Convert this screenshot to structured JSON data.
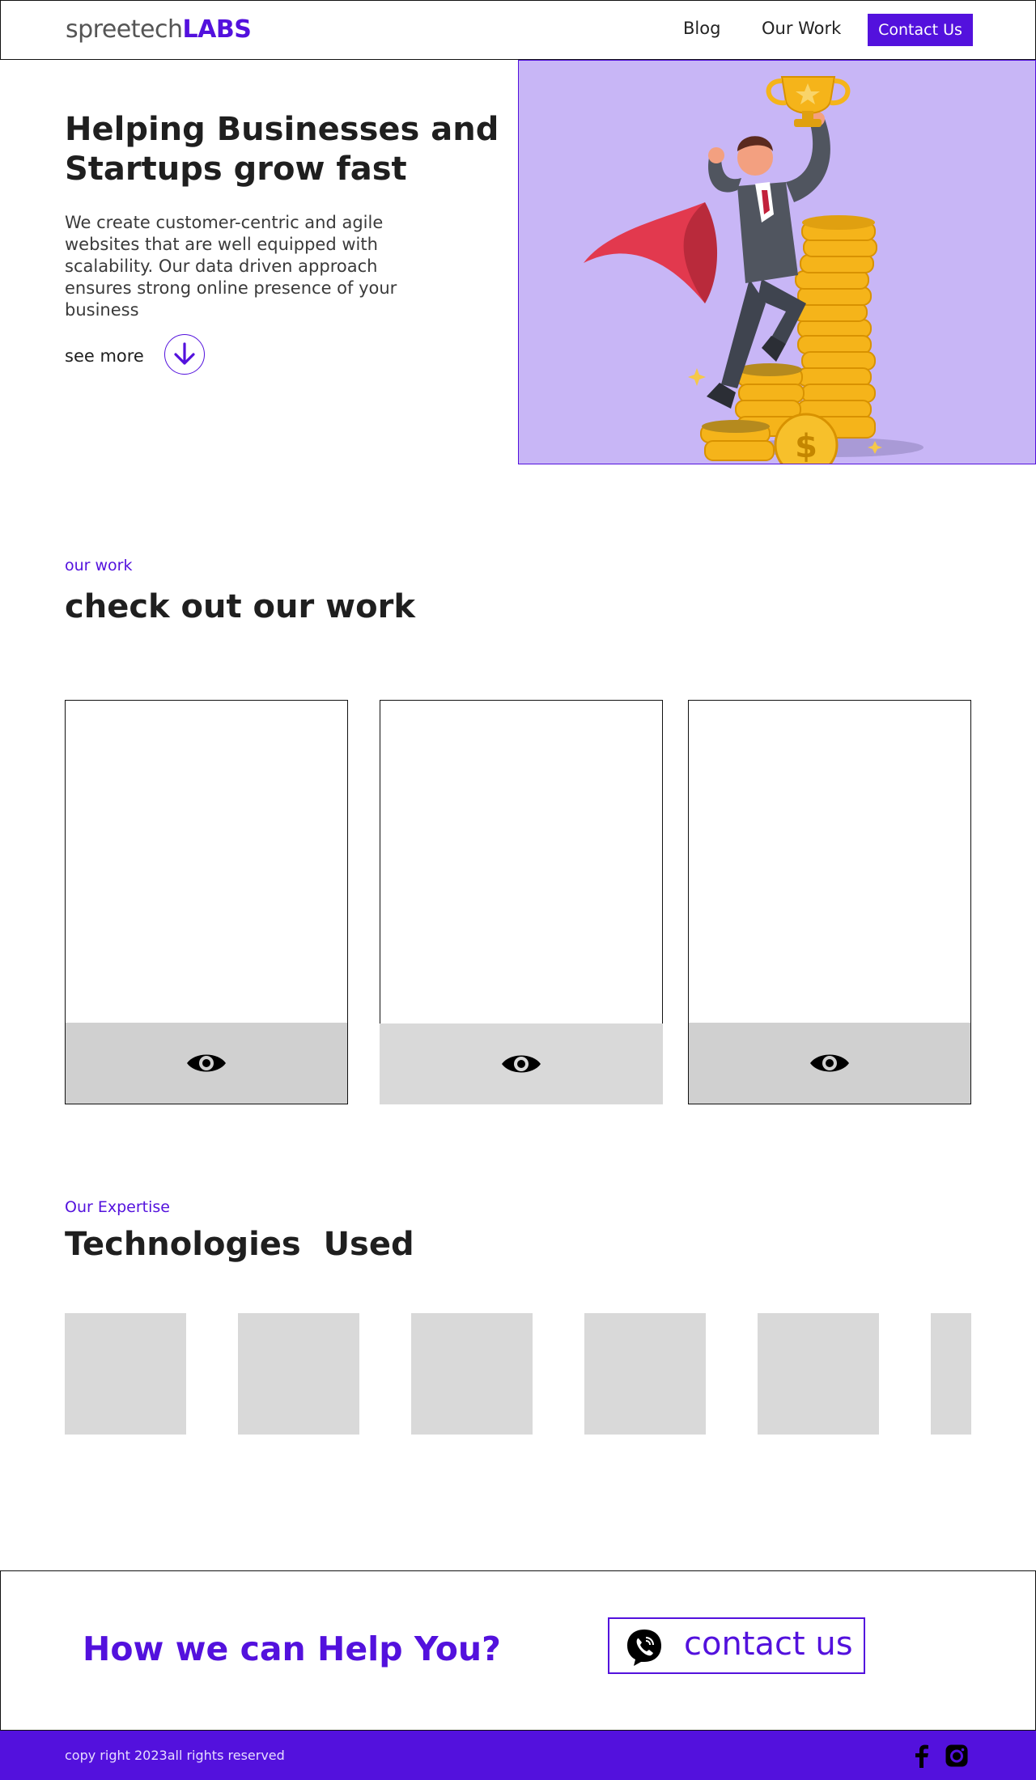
{
  "nav": {
    "logo_light": "spreetech",
    "logo_bold": "LABS",
    "links": [
      "Blog",
      "Our Work"
    ],
    "cta": "Contact Us"
  },
  "hero": {
    "title": "Helping Businesses and Startups grow fast",
    "description": "We create customer-centric and agile websites that are well equipped with scalability. Our data driven approach ensures strong online presence of your business",
    "see_more": "see more",
    "arrow_icon": "arrow-down-icon",
    "illustration": "businessman-superhero-with-trophy-and-coins",
    "illustration_bg": "#c8b6f6"
  },
  "work": {
    "eyebrow": "our work",
    "title": "check out our work",
    "cards": [
      {
        "icon": "eye-icon"
      },
      {
        "icon": "eye-icon"
      },
      {
        "icon": "eye-icon"
      }
    ]
  },
  "expertise": {
    "eyebrow": "Our Expertise",
    "title": "Technologies  Used",
    "tiles": 6
  },
  "help": {
    "title": "How we can Help You?",
    "button": "contact us",
    "button_icon": "viber-phone-icon"
  },
  "footer": {
    "copyright": "copy right 2023all rights reserved",
    "social": [
      "facebook-icon",
      "instagram-icon"
    ]
  },
  "colors": {
    "accent": "#5311dd",
    "tile": "#d9d9d9",
    "card_footer": "#d0d0d0"
  }
}
